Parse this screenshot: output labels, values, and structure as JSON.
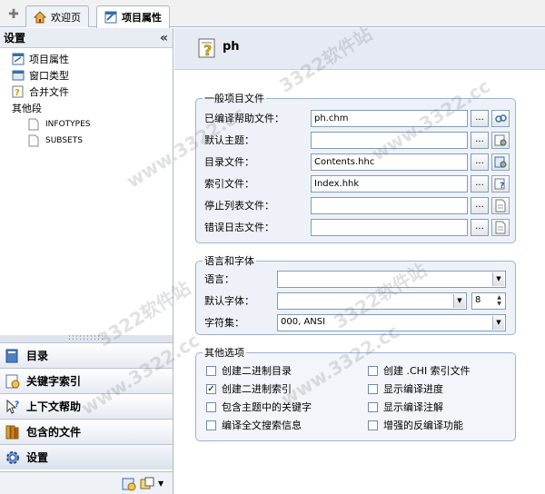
{
  "tabs": [
    {
      "label": "欢迎页"
    },
    {
      "label": "项目属性"
    }
  ],
  "left": {
    "header": "设置",
    "collapse_glyph": "«",
    "tree": [
      {
        "label": "项目属性"
      },
      {
        "label": "窗口类型"
      },
      {
        "label": "合并文件"
      },
      {
        "label": "其他段"
      },
      {
        "label": "INFOTYPES"
      },
      {
        "label": "SUBSETS"
      }
    ],
    "splitter_glyph": "::::::::::",
    "nav": [
      {
        "label": "目录"
      },
      {
        "label": "关键字索引"
      },
      {
        "label": "上下文帮助"
      },
      {
        "label": "包含的文件"
      },
      {
        "label": "设置"
      }
    ]
  },
  "right": {
    "title": "ph",
    "general": {
      "legend": "一般项目文件",
      "fields": [
        {
          "label": "已编译帮助文件：",
          "value": "ph.chm"
        },
        {
          "label": "默认主题：",
          "value": ""
        },
        {
          "label": "目录文件：",
          "value": "Contents.hhc"
        },
        {
          "label": "索引文件：",
          "value": "Index.hhk"
        },
        {
          "label": "停止列表文件：",
          "value": ""
        },
        {
          "label": "错误日志文件：",
          "value": ""
        }
      ],
      "browse_label": "..."
    },
    "lang": {
      "legend": "语言和字体",
      "language_label": "语言：",
      "language_value": "",
      "font_label": "默认字体：",
      "font_value": "",
      "font_size": "8",
      "charset_label": "字符集：",
      "charset_value": "000, ANSI"
    },
    "other": {
      "legend": "其他选项",
      "options": [
        {
          "label": "创建二进制目录",
          "checked": false
        },
        {
          "label": "创建 .CHI 索引文件",
          "checked": false
        },
        {
          "label": "创建二进制索引",
          "checked": true
        },
        {
          "label": "显示编译进度",
          "checked": false
        },
        {
          "label": "包含主题中的关键字",
          "checked": false
        },
        {
          "label": "显示编译注解",
          "checked": false
        },
        {
          "label": "编译全文搜索信息",
          "checked": false
        },
        {
          "label": "增强的反编译功能",
          "checked": false
        }
      ]
    }
  },
  "watermarks": [
    "3322软件站",
    "www.3322.cc"
  ],
  "colors": {
    "accent": "#9eb2d4",
    "header_bg": "#e6ebf3"
  }
}
